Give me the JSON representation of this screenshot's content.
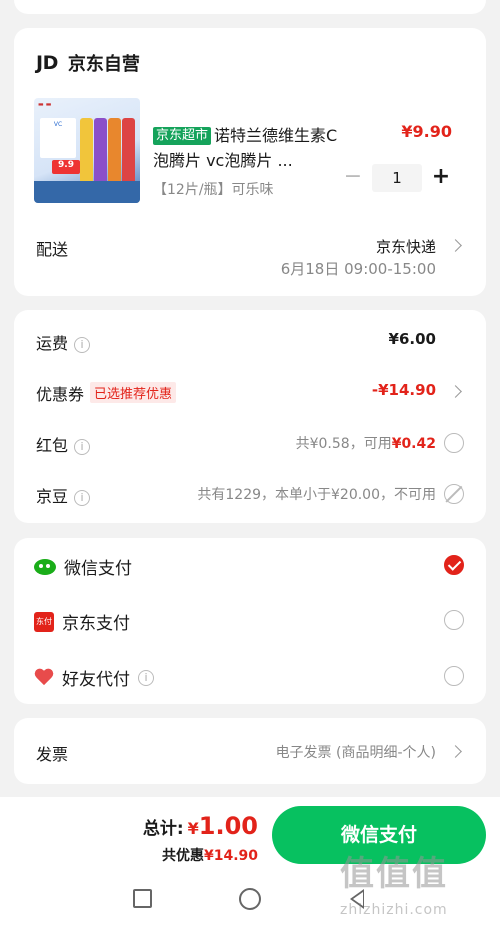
{
  "shop": {
    "logo": "JD",
    "name": "京东自营"
  },
  "product": {
    "tag": "京东超市",
    "title": "诺特兰德维生素C泡腾片 vc泡腾片 ...",
    "spec": "【12片/瓶】可乐味",
    "price": "¥9.90",
    "quantity": "1",
    "image_text": "9.9"
  },
  "delivery": {
    "label": "配送",
    "method": "京东快递",
    "time": "6月18日 09:00-15:00"
  },
  "fees": {
    "shipping_label": "运费",
    "shipping_value": "¥6.00",
    "coupon_label": "优惠券",
    "coupon_tag": "已选推荐优惠",
    "coupon_value": "-¥14.90",
    "redpacket_label": "红包",
    "redpacket_info_prefix": "共¥0.58，可用",
    "redpacket_available": "¥0.42",
    "jdbean_label": "京豆",
    "jdbean_info": "共有1229，本单小于¥20.00，不可用"
  },
  "payment": {
    "options": [
      {
        "label": "微信支付",
        "icon": "wechat-icon",
        "selected": true
      },
      {
        "label": "京东支付",
        "icon": "jdpay-icon",
        "selected": false
      },
      {
        "label": "好友代付",
        "icon": "heart-icon",
        "selected": false
      }
    ],
    "jdpay_icon_text": "东付"
  },
  "invoice": {
    "label": "发票",
    "value": "电子发票 (商品明细-个人)"
  },
  "footer": {
    "total_label": "总计:",
    "currency": "¥",
    "total_amount": "1.00",
    "discount_label": "共优惠",
    "discount_value": "¥14.90",
    "pay_button": "微信支付"
  },
  "watermark": {
    "text": "值值值",
    "site": "zhizhizhi.com"
  },
  "colors": {
    "accent_red": "#e2231a",
    "wechat_green": "#07c160",
    "jd_market_green": "#15a35b"
  }
}
